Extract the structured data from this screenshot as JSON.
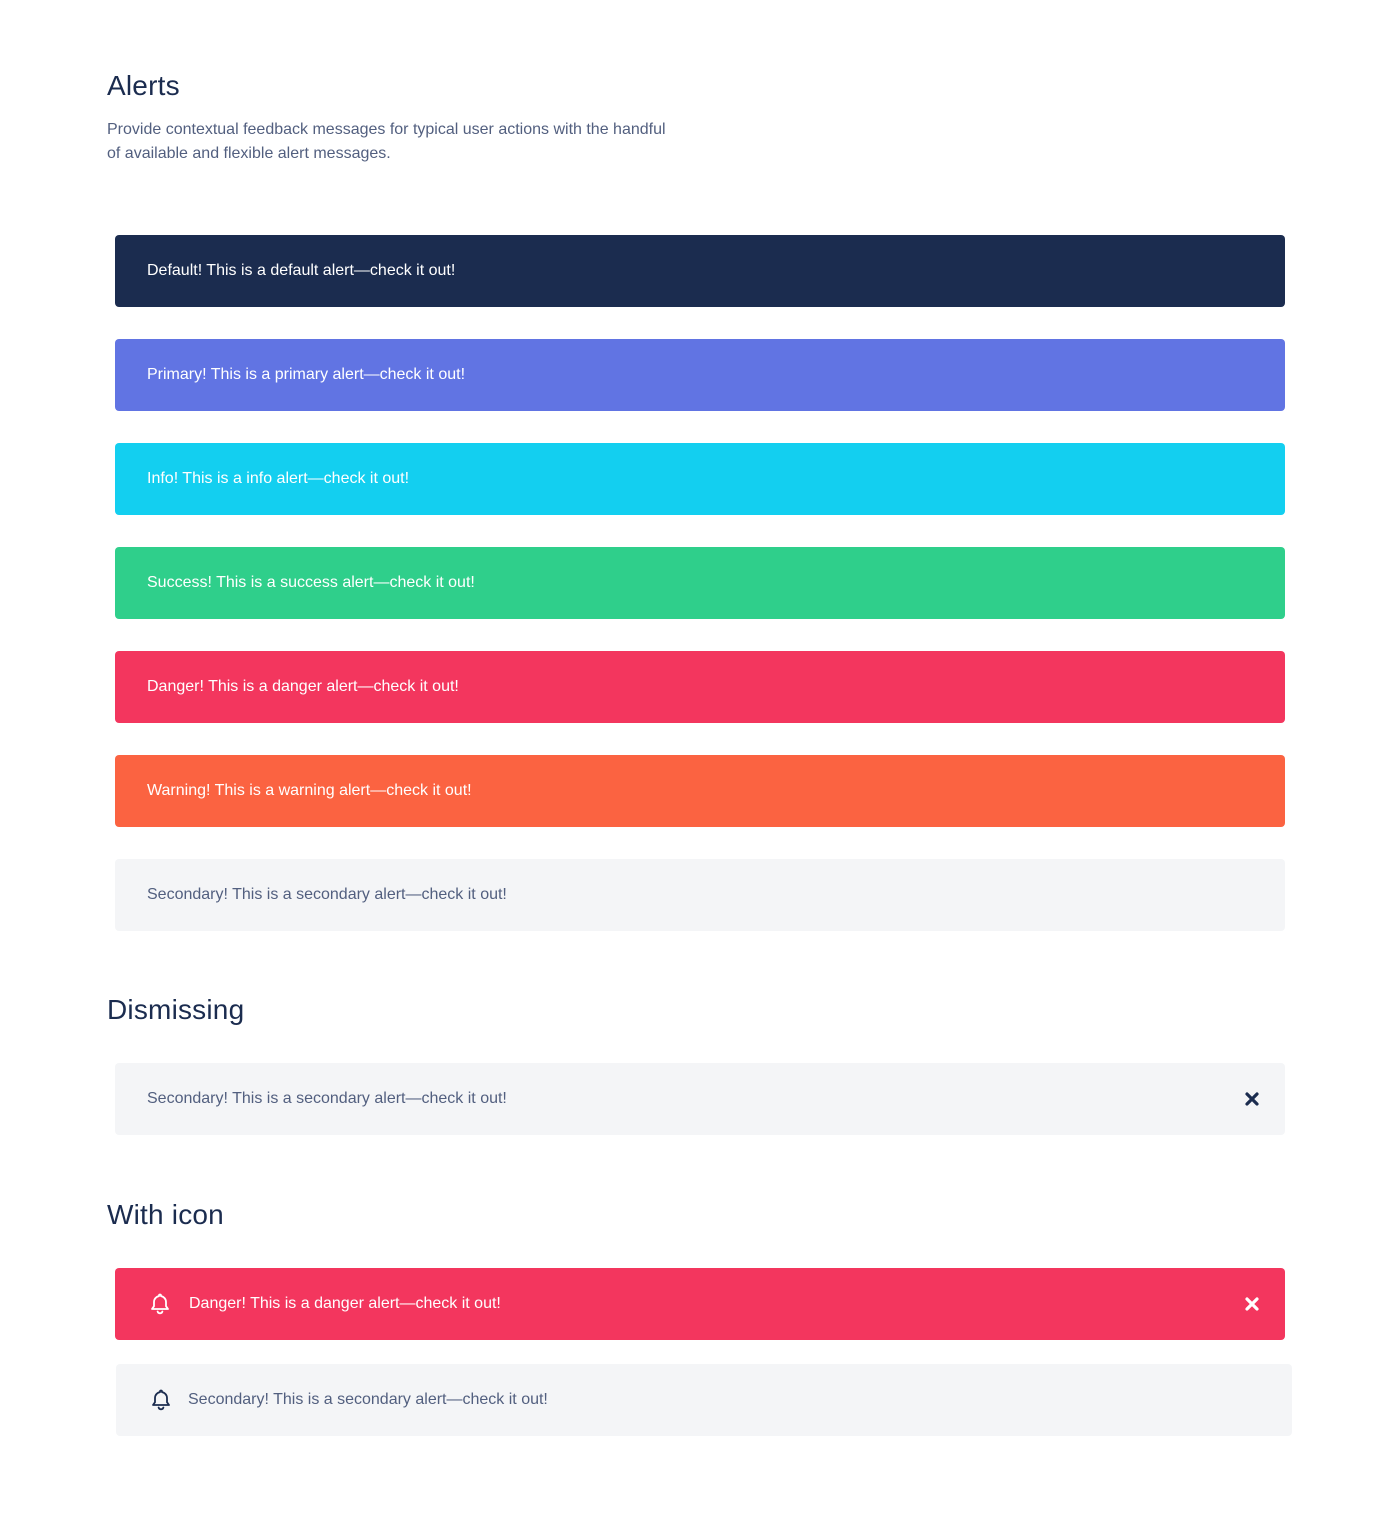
{
  "sections": {
    "alerts": {
      "title": "Alerts",
      "lead": "Provide contextual feedback messages for typical user actions with the handful of available and flexible alert messages."
    },
    "dismissing": {
      "title": "Dismissing"
    },
    "with_icon": {
      "title": "With icon"
    }
  },
  "alerts": [
    {
      "variant": "default",
      "text": "Default! This is a default alert—check it out!",
      "color": "#1b2c4f"
    },
    {
      "variant": "primary",
      "text": "Primary! This is a primary alert—check it out!",
      "color": "#6174e3"
    },
    {
      "variant": "info",
      "text": "Info! This is a info alert—check it out!",
      "color": "#13cff0"
    },
    {
      "variant": "success",
      "text": "Success! This is a success alert—check it out!",
      "color": "#2fcf8b"
    },
    {
      "variant": "danger",
      "text": "Danger! This is a danger alert—check it out!",
      "color": "#f3365e"
    },
    {
      "variant": "warning",
      "text": "Warning! This is a warning alert—check it out!",
      "color": "#fb6341"
    },
    {
      "variant": "secondary",
      "text": "Secondary! This is a secondary alert—check it out!",
      "color": "#f4f5f7"
    }
  ],
  "dismissing": {
    "text": "Secondary! This is a secondary alert—check it out!",
    "color": "#f4f5f7",
    "close_icon": "close-icon"
  },
  "with_icon": [
    {
      "variant": "danger",
      "text": "Danger! This is a danger alert—check it out!",
      "color": "#f3365e",
      "icon": "bell-icon",
      "close_icon": "close-icon"
    },
    {
      "variant": "secondary",
      "text": "Secondary! This is a secondary alert—check it out!",
      "color": "#f4f5f7",
      "icon": "bell-icon"
    }
  ]
}
